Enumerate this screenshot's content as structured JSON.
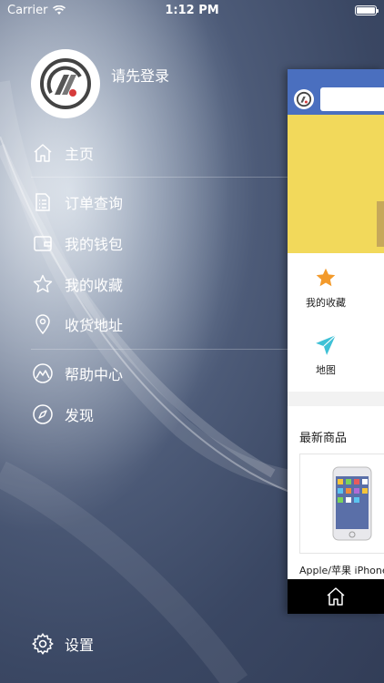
{
  "status_bar": {
    "carrier": "Carrier",
    "time": "1:12 PM"
  },
  "profile": {
    "login_prompt": "请先登录"
  },
  "menu": {
    "items": [
      {
        "label": "主页",
        "icon": "home-icon"
      },
      {
        "label": "订单查询",
        "icon": "order-list-icon"
      },
      {
        "label": "我的钱包",
        "icon": "wallet-icon"
      },
      {
        "label": "我的收藏",
        "icon": "star-icon"
      },
      {
        "label": "收货地址",
        "icon": "location-pin-icon"
      },
      {
        "label": "帮助中心",
        "icon": "mountain-icon"
      },
      {
        "label": "发现",
        "icon": "compass-icon"
      }
    ],
    "settings_label": "设置"
  },
  "preview": {
    "grid": [
      {
        "label": "我的收藏",
        "icon": "star-icon"
      },
      {
        "label": "地图",
        "icon": "paper-plane-icon"
      }
    ],
    "section_title": "最新商品",
    "product_name": "Apple/苹果 iPhone",
    "colors": {
      "topbar": "#4a6fbf",
      "banner": "#f2d95b",
      "star": "#f39a2b",
      "plane": "#3fc1d6"
    }
  }
}
